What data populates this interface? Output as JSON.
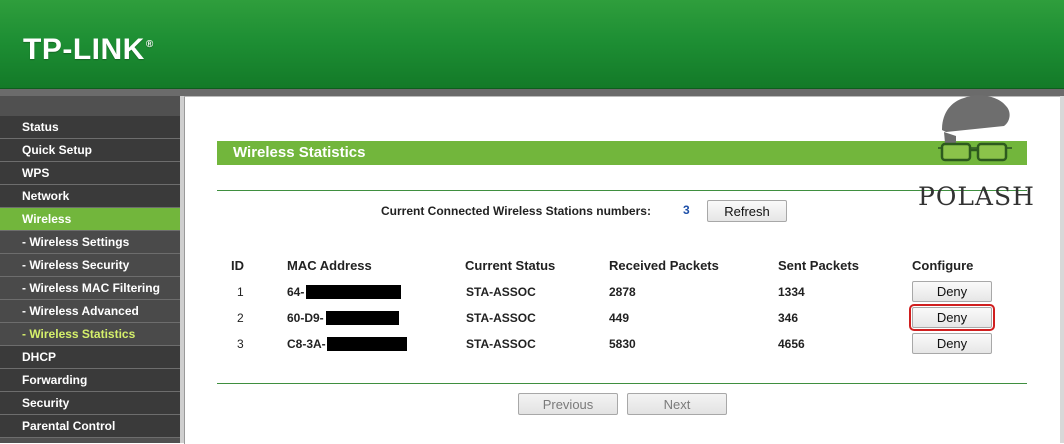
{
  "header": {
    "logo": "TP-LINK",
    "logo_mark": "®"
  },
  "sidebar": {
    "items": [
      {
        "label": "Status",
        "state": "normal"
      },
      {
        "label": "Quick Setup",
        "state": "normal"
      },
      {
        "label": "WPS",
        "state": "normal"
      },
      {
        "label": "Network",
        "state": "normal"
      },
      {
        "label": "Wireless",
        "state": "active"
      },
      {
        "label": "- Wireless Settings",
        "state": "sub"
      },
      {
        "label": "- Wireless Security",
        "state": "sub"
      },
      {
        "label": "- Wireless MAC Filtering",
        "state": "sub"
      },
      {
        "label": "- Wireless Advanced",
        "state": "sub"
      },
      {
        "label": "- Wireless Statistics",
        "state": "sub-active"
      },
      {
        "label": "DHCP",
        "state": "normal"
      },
      {
        "label": "Forwarding",
        "state": "normal"
      },
      {
        "label": "Security",
        "state": "normal"
      },
      {
        "label": "Parental Control",
        "state": "normal"
      }
    ]
  },
  "main": {
    "title": "Wireless Statistics",
    "stations_label": "Current Connected Wireless Stations numbers:",
    "stations_count": "3",
    "refresh_label": "Refresh",
    "columns": [
      "ID",
      "MAC Address",
      "Current Status",
      "Received Packets",
      "Sent Packets",
      "Configure"
    ],
    "rows": [
      {
        "id": "1",
        "mac": "64-",
        "status": "STA-ASSOC",
        "received": "2878",
        "sent": "1334",
        "action": "Deny"
      },
      {
        "id": "2",
        "mac": "60-D9-",
        "status": "STA-ASSOC",
        "received": "449",
        "sent": "346",
        "action": "Deny"
      },
      {
        "id": "3",
        "mac": "C8-3A-",
        "status": "STA-ASSOC",
        "received": "5830",
        "sent": "4656",
        "action": "Deny"
      }
    ],
    "previous_label": "Previous",
    "next_label": "Next"
  },
  "watermark": {
    "text": "POLASH"
  },
  "colors": {
    "brand_green": "#1e8f34",
    "accent_green": "#72b63c",
    "sidebar_bg": "#3a3a3a",
    "active_sub_text": "#d5f06b",
    "highlight_red": "#d01f1f"
  }
}
